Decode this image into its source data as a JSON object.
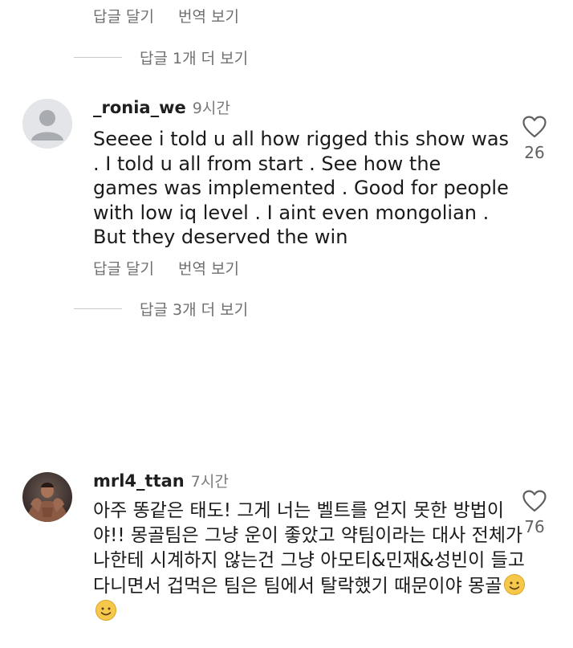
{
  "top_actions": {
    "reply": "답글 달기",
    "translate": "번역 보기"
  },
  "top_more_replies": "답글 1개 더 보기",
  "comments": [
    {
      "username": "_ronia_we",
      "time": "9시간",
      "text": "Seeee i told u all how rigged this show was . I told u all from start . See how the games was implemented . Good for people with low iq level . I aint even mongolian . But they deserved the win",
      "likes": "26",
      "reply_label": "답글 달기",
      "translate_label": "번역 보기",
      "more_replies": "답글 3개 더 보기"
    },
    {
      "username": "mrl4_ttan",
      "time": "7시간",
      "text": "아주 똥같은 태도! 그게 너는 벨트를 얻지 못한 방법이야!! 몽골팀은 그냥 운이 좋았고 약팀이라는 대사 전체가 나한테 시계하지 않는건 그냥 아모티&민재&성빈이 들고다니면서 겁먹은 팀은 팀에서 탈락했기 때문이야 몽골",
      "emoji": "smiling-face-emoji",
      "likes": "76"
    }
  ],
  "icons": {
    "like": "heart-outline-icon",
    "avatar_default": "default-avatar-icon"
  },
  "colors": {
    "secondary_text": "#6f6f6f",
    "primary_text": "#1f1f1f",
    "emoji": "#f5c84c"
  }
}
